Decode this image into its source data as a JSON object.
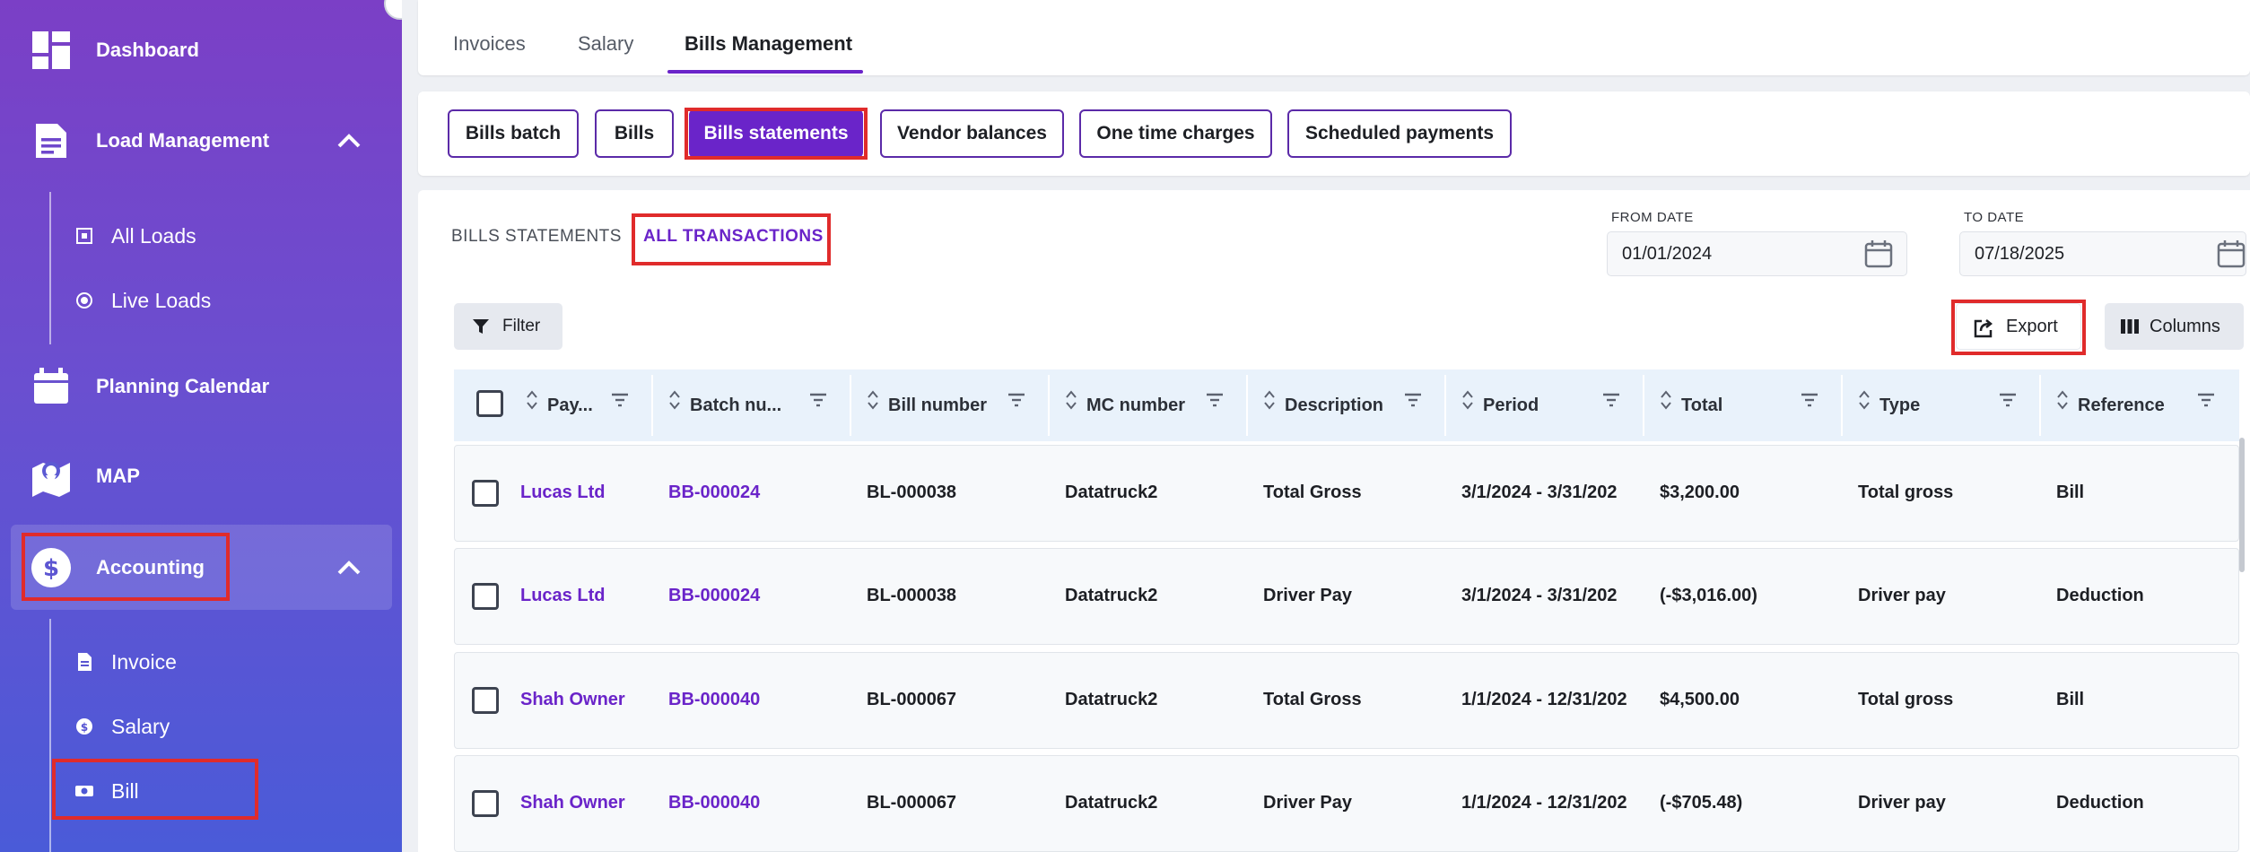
{
  "sidebar": {
    "dashboard": "Dashboard",
    "load_management": "Load Management",
    "all_loads": "All Loads",
    "live_loads": "Live Loads",
    "planning_calendar": "Planning Calendar",
    "map": "MAP",
    "accounting": "Accounting",
    "invoice": "Invoice",
    "salary": "Salary",
    "bill": "Bill"
  },
  "tabs": [
    "Invoices",
    "Salary",
    "Bills Management"
  ],
  "pills": [
    "Bills batch",
    "Bills",
    "Bills statements",
    "Vendor balances",
    "One time charges",
    "Scheduled payments"
  ],
  "sub_tabs": [
    "BILLS STATEMENTS",
    "ALL TRANSACTIONS"
  ],
  "from_date": {
    "label": "FROM DATE",
    "value": "01/01/2024"
  },
  "to_date": {
    "label": "TO DATE",
    "value": "07/18/2025"
  },
  "filter_label": "Filter",
  "export_label": "Export",
  "columns_label": "Columns",
  "table": {
    "headers": [
      "Pay...",
      "Batch nu...",
      "Bill number",
      "MC number",
      "Description",
      "Period",
      "Total",
      "Type",
      "Reference"
    ],
    "rows": [
      [
        "Lucas Ltd",
        "BB-000024",
        "BL-000038",
        "Datatruck2",
        "Total Gross",
        "3/1/2024 - 3/31/202",
        "$3,200.00",
        "Total gross",
        "Bill"
      ],
      [
        "Lucas Ltd",
        "BB-000024",
        "BL-000038",
        "Datatruck2",
        "Driver Pay",
        "3/1/2024 - 3/31/202",
        "(-$3,016.00)",
        "Driver pay",
        "Deduction"
      ],
      [
        "Shah Owner",
        "BB-000040",
        "BL-000067",
        "Datatruck2",
        "Total Gross",
        "1/1/2024 - 12/31/202",
        "$4,500.00",
        "Total gross",
        "Bill"
      ],
      [
        "Shah Owner",
        "BB-000040",
        "BL-000067",
        "Datatruck2",
        "Driver Pay",
        "1/1/2024 - 12/31/202",
        "(-$705.48)",
        "Driver pay",
        "Deduction"
      ]
    ]
  },
  "colors": {
    "accent": "#6a24c9",
    "highlight": "#e02b2b"
  }
}
